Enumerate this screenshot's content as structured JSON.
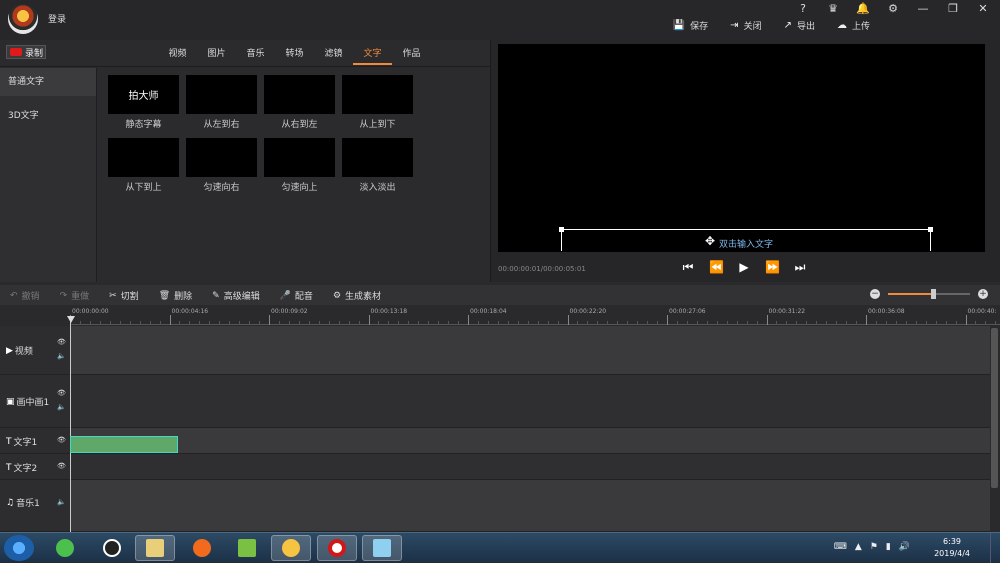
{
  "titlebar": {
    "login": "登录",
    "window_icons": [
      "?",
      "♛",
      "🔔",
      "⚙",
      "—",
      "❐",
      "✕"
    ],
    "actions": [
      {
        "icon": "save-icon",
        "glyph": "💾",
        "label": "保存"
      },
      {
        "icon": "close-doc-icon",
        "glyph": "⇥",
        "label": "关闭"
      },
      {
        "icon": "export-icon",
        "glyph": "↗",
        "label": "导出"
      },
      {
        "icon": "upload-icon",
        "glyph": "☁",
        "label": "上传"
      }
    ]
  },
  "left_panel": {
    "record_label": "录制",
    "tabs": [
      "视频",
      "图片",
      "音乐",
      "转场",
      "滤镜",
      "文字",
      "作品"
    ],
    "active_tab": "文字",
    "sidebar": [
      "普通文字",
      "3D文字"
    ],
    "templates": [
      {
        "thumb_text": "拍大师",
        "caption": "静态字幕"
      },
      {
        "thumb_text": "",
        "caption": "从左到右"
      },
      {
        "thumb_text": "",
        "caption": "从右到左"
      },
      {
        "thumb_text": "",
        "caption": "从上到下"
      },
      {
        "thumb_text": "",
        "caption": "从下到上"
      },
      {
        "thumb_text": "",
        "caption": "匀速向右"
      },
      {
        "thumb_text": "",
        "caption": "匀速向上"
      },
      {
        "thumb_text": "",
        "caption": "淡入淡出"
      }
    ]
  },
  "preview": {
    "text_placeholder": "双击输入文字",
    "timecode": "00:00:00:01/00:00:05:01",
    "controls": [
      "⏮",
      "⏪",
      "▶",
      "⏩",
      "⏭"
    ]
  },
  "edit_toolbar": {
    "tools": [
      {
        "icon": "undo-icon",
        "glyph": "↶",
        "label": "撤销",
        "enabled": false
      },
      {
        "icon": "redo-icon",
        "glyph": "↷",
        "label": "重做",
        "enabled": false
      },
      {
        "icon": "cut-icon",
        "glyph": "✂",
        "label": "切割",
        "enabled": true
      },
      {
        "icon": "delete-icon",
        "glyph": "🗑",
        "label": "删除",
        "enabled": true
      },
      {
        "icon": "advanced-edit-icon",
        "glyph": "✎",
        "label": "高级编辑",
        "enabled": true
      },
      {
        "icon": "dub-icon",
        "glyph": "🎤",
        "label": "配音",
        "enabled": true
      },
      {
        "icon": "generate-material-icon",
        "glyph": "⚙",
        "label": "生成素材",
        "enabled": true
      }
    ],
    "zoom_level": 0.55
  },
  "timeline": {
    "ruler_labels": [
      "00:00:00:00",
      "00:00:04:16",
      "00:00:09:02",
      "00:00:13:18",
      "00:00:18:04",
      "00:00:22:20",
      "00:00:27:06",
      "00:00:31:22",
      "00:00:36:08",
      "00:00:40:"
    ],
    "tracks": [
      {
        "icon": "▶",
        "name": "视频",
        "eye": true,
        "speaker": true
      },
      {
        "icon": "▣",
        "name": "画中画1",
        "eye": true,
        "speaker": true
      },
      {
        "icon": "T",
        "name": "文字1",
        "eye": true,
        "speaker": false
      },
      {
        "icon": "T",
        "name": "文字2",
        "eye": true,
        "speaker": false
      },
      {
        "icon": "♫",
        "name": "音乐1",
        "eye": false,
        "speaker": true
      }
    ]
  },
  "taskbar": {
    "apps": [
      "ie",
      "qq",
      "explorer",
      "firefox",
      "video-player",
      "paidashi",
      "recorder",
      "notes"
    ],
    "time": "6:39",
    "date": "2019/4/4"
  }
}
